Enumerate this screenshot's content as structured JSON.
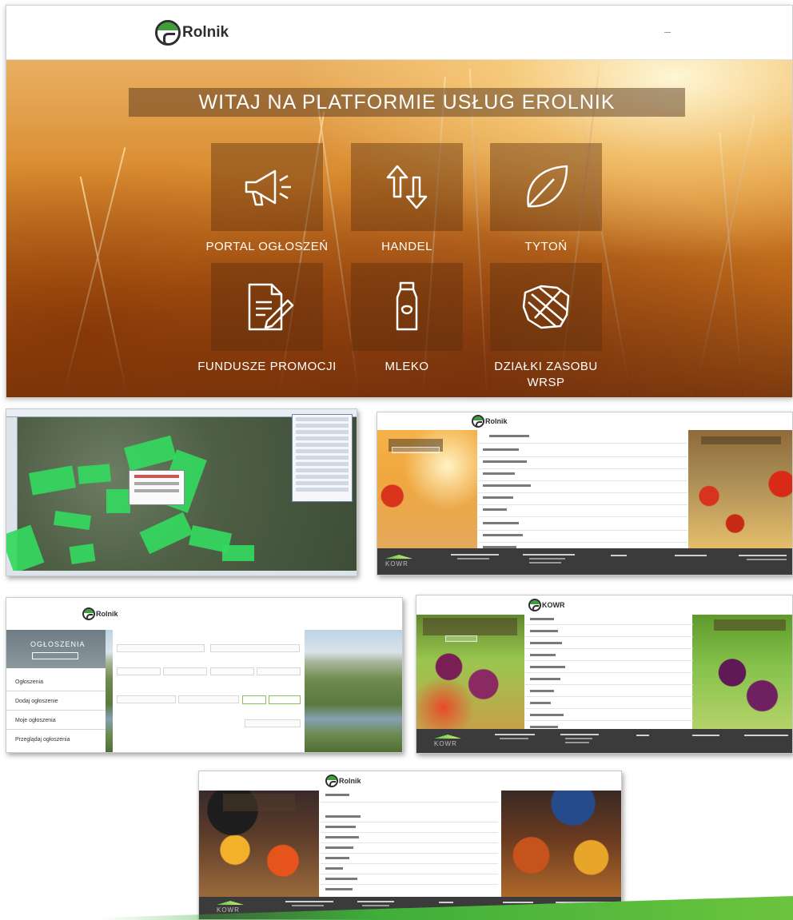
{
  "hero": {
    "brand": "Rolnik",
    "title": "WITAJ NA PLATFORMIE USŁUG EROLNIK",
    "tiles": [
      {
        "label": "PORTAL OGŁOSZEŃ",
        "icon": "megaphone-icon"
      },
      {
        "label": "HANDEL",
        "icon": "arrows-up-down-icon"
      },
      {
        "label": "TYTOŃ",
        "icon": "leaf-icon"
      },
      {
        "label": "FUNDUSZE PROMOCJI",
        "icon": "document-pen-icon"
      },
      {
        "label": "MLEKO",
        "icon": "milk-bottle-icon"
      },
      {
        "label": "DZIAŁKI ZASOBU WRSP",
        "icon": "poland-map-icon"
      }
    ]
  },
  "shots": {
    "adform": {
      "brand": "Rolnik",
      "side_title": "OGŁOSZENIA",
      "side_items": [
        "Ogłoszenia",
        "Dodaj ogłoszenie",
        "Moje ogłoszenia",
        "Przeglądaj ogłoszenia"
      ]
    },
    "grapes": {
      "brand": "KOWR"
    },
    "footer_brand": "KOWR"
  },
  "colors": {
    "brand_green": "#3f9d3a",
    "footer_gray": "#3b3b3b",
    "hero_tile": "#5a2d0f"
  }
}
